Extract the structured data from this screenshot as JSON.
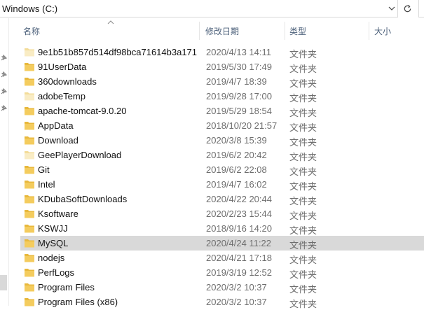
{
  "address": {
    "path": "Windows (C:)"
  },
  "columns": {
    "name": "名称",
    "date": "修改日期",
    "type": "类型",
    "size": "大小"
  },
  "colors": {
    "folder": "#f2c94c",
    "folder_light": "#f8e5a8",
    "selected_row": "#d9d9d9",
    "header_text": "#4c607a"
  },
  "files": [
    {
      "name": "9e1b51b857d514df98bca71614b3a171",
      "date": "2020/4/13 14:11",
      "type": "文件夹",
      "icon": "folder-faded-icon"
    },
    {
      "name": "91UserData",
      "date": "2019/5/30 17:49",
      "type": "文件夹",
      "icon": "folder-icon"
    },
    {
      "name": "360downloads",
      "date": "2019/4/7 18:39",
      "type": "文件夹",
      "icon": "folder-icon"
    },
    {
      "name": "adobeTemp",
      "date": "2019/9/28 17:00",
      "type": "文件夹",
      "icon": "folder-faded-icon"
    },
    {
      "name": "apache-tomcat-9.0.20",
      "date": "2019/5/29 18:54",
      "type": "文件夹",
      "icon": "folder-icon"
    },
    {
      "name": "AppData",
      "date": "2018/10/20 21:57",
      "type": "文件夹",
      "icon": "folder-icon"
    },
    {
      "name": "Download",
      "date": "2020/3/8 15:39",
      "type": "文件夹",
      "icon": "folder-icon"
    },
    {
      "name": "GeePlayerDownload",
      "date": "2019/6/2 20:42",
      "type": "文件夹",
      "icon": "folder-faded-icon"
    },
    {
      "name": "Git",
      "date": "2019/6/2 22:08",
      "type": "文件夹",
      "icon": "folder-icon"
    },
    {
      "name": "Intel",
      "date": "2019/4/7 16:02",
      "type": "文件夹",
      "icon": "folder-icon"
    },
    {
      "name": "KDubaSoftDownloads",
      "date": "2020/4/22 20:44",
      "type": "文件夹",
      "icon": "folder-icon"
    },
    {
      "name": "Ksoftware",
      "date": "2020/2/23 15:44",
      "type": "文件夹",
      "icon": "folder-icon"
    },
    {
      "name": "KSWJJ",
      "date": "2018/9/16 14:20",
      "type": "文件夹",
      "icon": "folder-icon"
    },
    {
      "name": "MySQL",
      "date": "2020/4/24 11:22",
      "type": "文件夹",
      "icon": "folder-icon",
      "selected": true
    },
    {
      "name": "nodejs",
      "date": "2020/4/21 17:18",
      "type": "文件夹",
      "icon": "folder-icon"
    },
    {
      "name": "PerfLogs",
      "date": "2019/3/19 12:52",
      "type": "文件夹",
      "icon": "folder-icon"
    },
    {
      "name": "Program Files",
      "date": "2020/3/2 10:37",
      "type": "文件夹",
      "icon": "folder-icon"
    },
    {
      "name": "Program Files (x86)",
      "date": "2020/3/2 10:37",
      "type": "文件夹",
      "icon": "folder-icon"
    }
  ]
}
